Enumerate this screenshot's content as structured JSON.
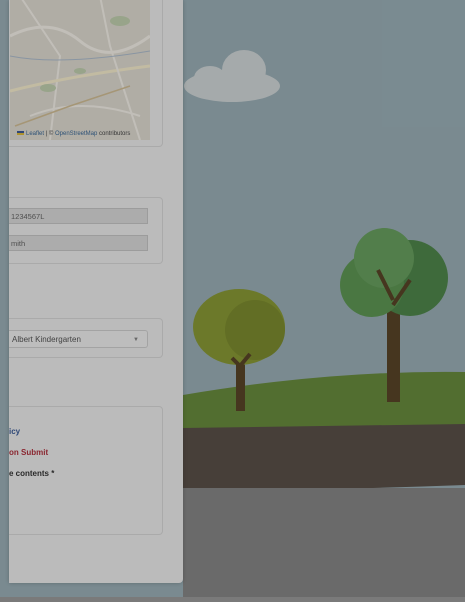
{
  "map": {
    "attribution_leaflet": "Leaflet",
    "attribution_sep": " | © ",
    "attribution_osm": "OpenStreetMap",
    "attribution_suffix": " contributors"
  },
  "form": {
    "id_value": "1234567L",
    "name_value": "mith",
    "school_select": "Albert Kindergarten",
    "link_policy": "icy",
    "link_submit": "on Submit",
    "label_contents": "e contents *"
  },
  "colors": {
    "sky": "#8fa5ad",
    "grass": "#5a7f2d",
    "soil": "#4b4038",
    "road": "#7a7a7a"
  }
}
